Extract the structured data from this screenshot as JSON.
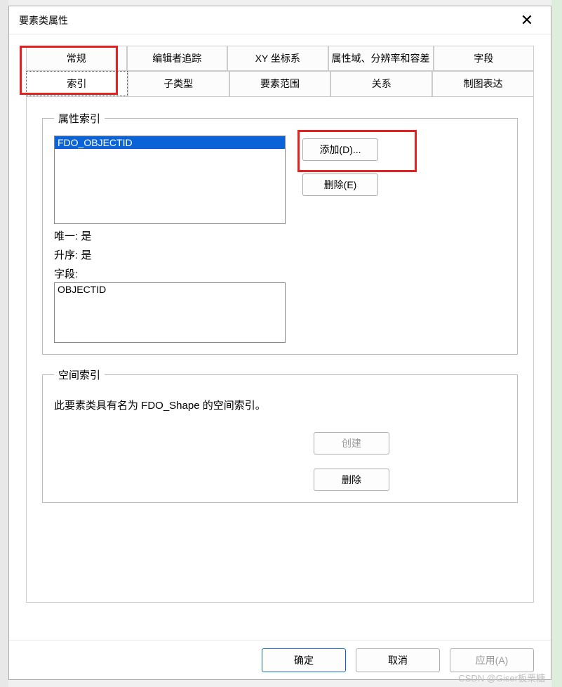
{
  "dialog": {
    "title": "要素类属性"
  },
  "tabs": {
    "row1": [
      "常规",
      "编辑者追踪",
      "XY 坐标系",
      "属性域、分辨率和容差",
      "字段"
    ],
    "row2": [
      "索引",
      "子类型",
      "要素范围",
      "关系",
      "制图表达"
    ],
    "active": "索引"
  },
  "attrIndex": {
    "legend": "属性索引",
    "items": [
      "FDO_OBJECTID"
    ],
    "selected": "FDO_OBJECTID",
    "unique_label": "唯一:",
    "unique_value": "是",
    "ascending_label": "升序:",
    "ascending_value": "是",
    "fields_label": "字段:",
    "fields_value": "OBJECTID",
    "add_button": "添加(D)...",
    "delete_button": "删除(E)"
  },
  "spatialIndex": {
    "legend": "空间索引",
    "description": "此要素类具有名为 FDO_Shape 的空间索引。",
    "create_button": "创建",
    "delete_button": "删除"
  },
  "footer": {
    "ok": "确定",
    "cancel": "取消",
    "apply": "应用(A)"
  },
  "watermark": "CSDN @Giser板栗糖"
}
